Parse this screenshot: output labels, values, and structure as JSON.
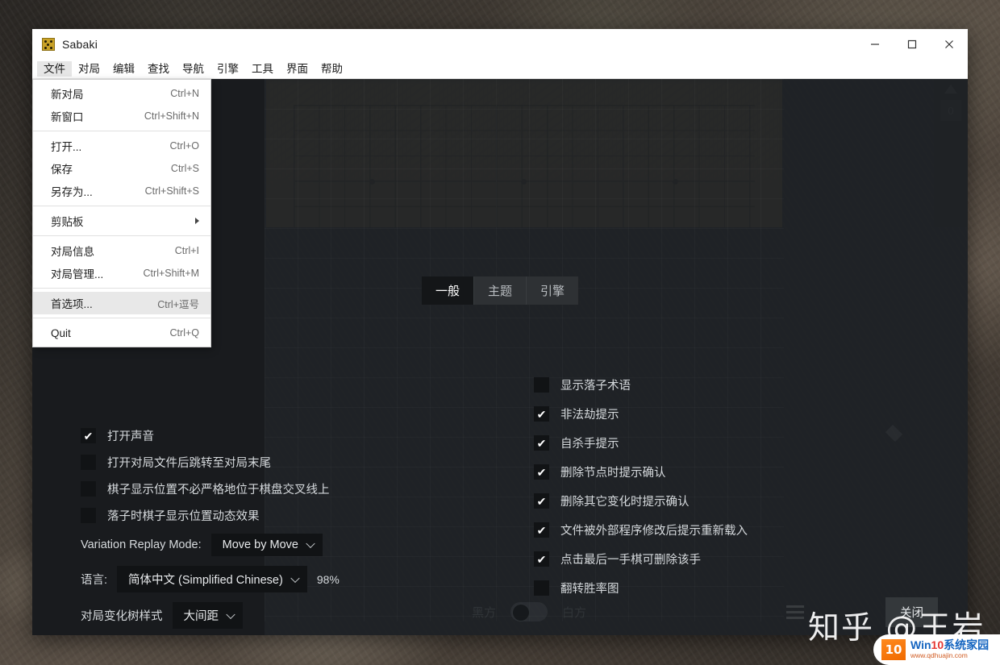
{
  "window": {
    "title": "Sabaki",
    "controls": {
      "minimize": "─",
      "maximize": "□",
      "close": "✕"
    }
  },
  "menubar": {
    "items": [
      {
        "label": "文件",
        "active": true
      },
      {
        "label": "对局",
        "active": false
      },
      {
        "label": "编辑",
        "active": false
      },
      {
        "label": "查找",
        "active": false
      },
      {
        "label": "导航",
        "active": false
      },
      {
        "label": "引擎",
        "active": false
      },
      {
        "label": "工具",
        "active": false
      },
      {
        "label": "界面",
        "active": false
      },
      {
        "label": "帮助",
        "active": false
      }
    ]
  },
  "file_menu": {
    "groups": [
      [
        {
          "label": "新对局",
          "accel": "Ctrl+N"
        },
        {
          "label": "新窗口",
          "accel": "Ctrl+Shift+N"
        }
      ],
      [
        {
          "label": "打开...",
          "accel": "Ctrl+O"
        },
        {
          "label": "保存",
          "accel": "Ctrl+S"
        },
        {
          "label": "另存为...",
          "accel": "Ctrl+Shift+S"
        }
      ],
      [
        {
          "label": "剪贴板",
          "accel": "",
          "submenu": true
        }
      ],
      [
        {
          "label": "对局信息",
          "accel": "Ctrl+I"
        },
        {
          "label": "对局管理...",
          "accel": "Ctrl+Shift+M"
        }
      ],
      [
        {
          "label": "首选项...",
          "accel": "Ctrl+逗号",
          "selected": true
        }
      ],
      [
        {
          "label": "Quit",
          "accel": "Ctrl+Q"
        }
      ]
    ]
  },
  "right_rail": {
    "collapse_icon": "up-triangle",
    "badge": "0"
  },
  "preferences": {
    "tabs": [
      {
        "label": "一般",
        "active": true
      },
      {
        "label": "主题",
        "active": false
      },
      {
        "label": "引擎",
        "active": false
      }
    ],
    "left_options": [
      {
        "label": "打开声音",
        "checked": true
      },
      {
        "label": "打开对局文件后跳转至对局末尾",
        "checked": false
      },
      {
        "label": "棋子显示位置不必严格地位于棋盘交叉线上",
        "checked": false
      },
      {
        "label": "落子时棋子显示位置动态效果",
        "checked": false
      }
    ],
    "right_options": [
      {
        "label": "显示落子术语",
        "checked": false
      },
      {
        "label": "非法劫提示",
        "checked": true
      },
      {
        "label": "自杀手提示",
        "checked": true
      },
      {
        "label": "删除节点时提示确认",
        "checked": true
      },
      {
        "label": "删除其它变化时提示确认",
        "checked": true
      },
      {
        "label": "文件被外部程序修改后提示重新载入",
        "checked": true
      },
      {
        "label": "点击最后一手棋可删除该手",
        "checked": true
      },
      {
        "label": "翻转胜率图",
        "checked": false
      }
    ],
    "fields": [
      {
        "label": "Variation Replay Mode:",
        "value": "Move by Move",
        "suffix": ""
      },
      {
        "label": "语言:",
        "value": "简体中文 (Simplified Chinese)",
        "suffix": "98%"
      },
      {
        "label": "对局变化树样式",
        "value": "大间距",
        "suffix": ""
      }
    ],
    "close_button": "关闭"
  },
  "bottom_bar": {
    "black_player": "黑方",
    "white_player": "白方"
  },
  "watermarks": {
    "zhihu": "知乎 @王岩",
    "win10_badge": "10",
    "win10_main_a": "Win",
    "win10_main_b": "10",
    "win10_main_c": "系统家园",
    "win10_url": "www.qdhuajin.com"
  }
}
